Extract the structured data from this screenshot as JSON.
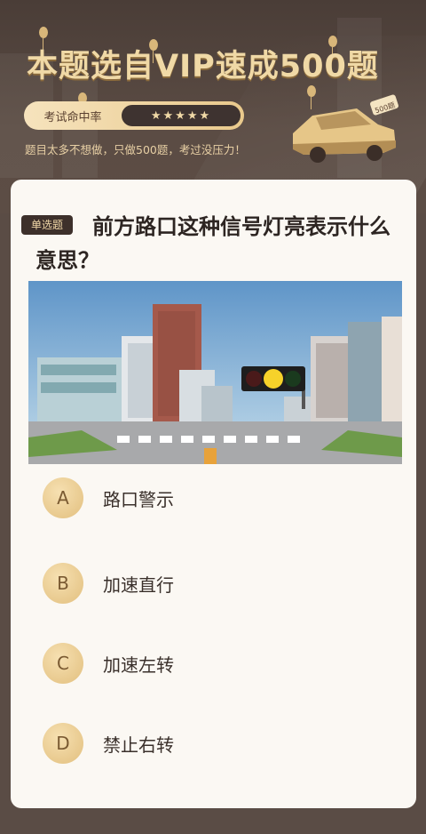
{
  "header": {
    "title": "本题选自VIP速成500题",
    "hit_rate_label": "考试命中率",
    "stars": "★★★★★",
    "subtitle": "题目太多不想做，只做500题，考过没压力！",
    "car_plate": "500题"
  },
  "question": {
    "type_tag": "单选题",
    "text": "前方路口这种信号灯亮表示什么意思？"
  },
  "options": [
    {
      "letter": "A",
      "text": "路口警示"
    },
    {
      "letter": "B",
      "text": "加速直行"
    },
    {
      "letter": "C",
      "text": "加速左转"
    },
    {
      "letter": "D",
      "text": "禁止右转"
    }
  ],
  "colors": {
    "background": "#5a4c45",
    "accent_gold": "#e9c98c",
    "card": "#fbf8f3",
    "signal_yellow": "#f6d22a"
  }
}
